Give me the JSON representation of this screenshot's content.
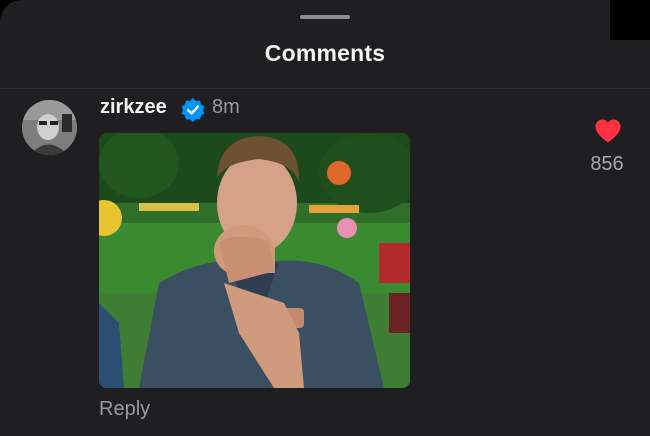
{
  "sheet": {
    "title": "Comments"
  },
  "comment": {
    "username": "zirkzee",
    "verified": true,
    "time": "8m",
    "reply_label": "Reply",
    "like_count": "856",
    "liked": true
  },
  "colors": {
    "background": "#1f1f21",
    "like_red": "#ff3040",
    "verified_blue": "#0095f6"
  }
}
